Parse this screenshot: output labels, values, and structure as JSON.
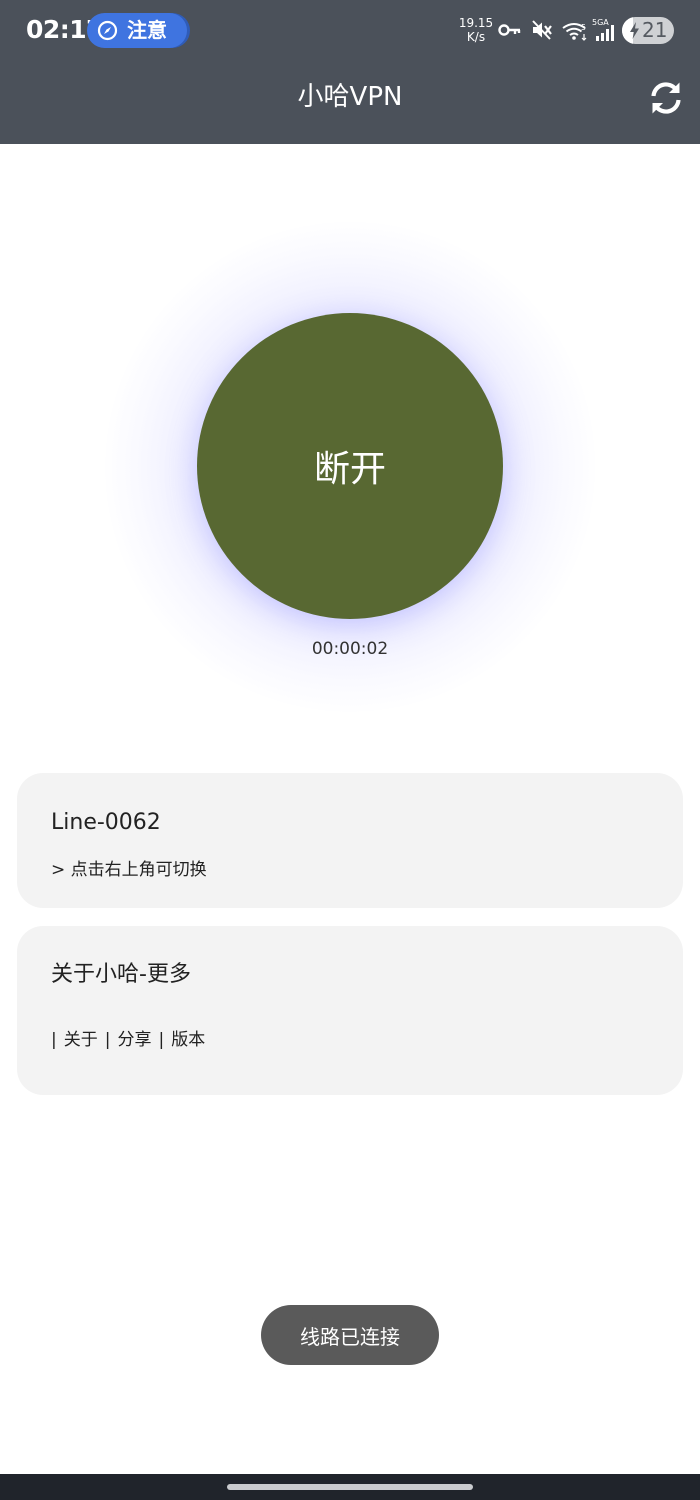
{
  "status_bar": {
    "time": "02:17",
    "attention_label": "注意",
    "net_speed_value": "19.15",
    "net_speed_unit": "K/s",
    "signal_label_small": "5",
    "network_type": "5GA",
    "battery_level": "21",
    "battery_fraction": 0.21,
    "icons": [
      "key-icon",
      "mute-icon",
      "wifi-icon",
      "cellular-signal-icon",
      "charging-icon"
    ]
  },
  "app_bar": {
    "title": "小哈VPN",
    "refresh_icon": "refresh-icon"
  },
  "connect": {
    "button_label": "断开",
    "elapsed": "00:00:02"
  },
  "line_card": {
    "title": "Line-0062",
    "hint": "> 点击右上角可切换"
  },
  "about_card": {
    "title": "关于小哈-更多",
    "separator": "|",
    "links": [
      "关于",
      "分享",
      "版本"
    ]
  },
  "toast": {
    "message": "线路已连接"
  },
  "colors": {
    "header_bg": "#4b515a",
    "connect_button": "#586832",
    "card_bg": "#f3f3f3",
    "toast_bg": "#5a5a5a",
    "attention_pill": "#3f74e0"
  }
}
